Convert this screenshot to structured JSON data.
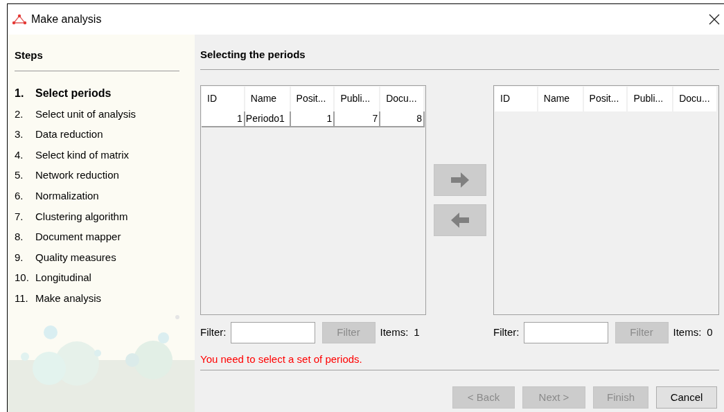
{
  "window": {
    "title": "Make analysis"
  },
  "steps_panel": {
    "title": "Steps",
    "items": [
      {
        "number": "1.",
        "label": "Select periods",
        "selected": true
      },
      {
        "number": "2.",
        "label": "Select unit of analysis",
        "selected": false
      },
      {
        "number": "3.",
        "label": "Data reduction",
        "selected": false
      },
      {
        "number": "4.",
        "label": "Select kind of matrix",
        "selected": false
      },
      {
        "number": "5.",
        "label": "Network reduction",
        "selected": false
      },
      {
        "number": "6.",
        "label": "Normalization",
        "selected": false
      },
      {
        "number": "7.",
        "label": "Clustering algorithm",
        "selected": false
      },
      {
        "number": "8.",
        "label": "Document mapper",
        "selected": false
      },
      {
        "number": "9.",
        "label": "Quality measures",
        "selected": false
      },
      {
        "number": "10.",
        "label": "Longitudinal",
        "selected": false
      },
      {
        "number": "11.",
        "label": "Make analysis",
        "selected": false
      }
    ]
  },
  "page_title": "Selecting the periods",
  "lists": [
    {
      "columns": [
        "ID",
        "Name",
        "Posit...",
        "Publi...",
        "Docu..."
      ],
      "rows": [
        [
          "1",
          "Periodo1",
          "1",
          "7",
          "8"
        ]
      ],
      "filter_label": "Filter:",
      "filter_button": {
        "label": "Filter",
        "disabled": true
      },
      "items_label": "Items:",
      "items_count": "1"
    },
    {
      "columns": [
        "ID",
        "Name",
        "Posit...",
        "Publi...",
        "Docu..."
      ],
      "filter_label": "Filter:",
      "filter_button": {
        "label": "Filter",
        "disabled": true
      },
      "items_label": "Items:",
      "items_count": "0"
    }
  ],
  "move_buttons": [
    {
      "kind": "right",
      "disabled": true
    },
    {
      "kind": "left",
      "disabled": true
    }
  ],
  "error_message": "You need to select a set of periods.",
  "buttons": [
    {
      "label": "< Back",
      "disabled": true
    },
    {
      "label": "Next >",
      "disabled": true
    },
    {
      "label": "Finish",
      "disabled": true
    },
    {
      "label": "Cancel",
      "disabled": false
    }
  ]
}
